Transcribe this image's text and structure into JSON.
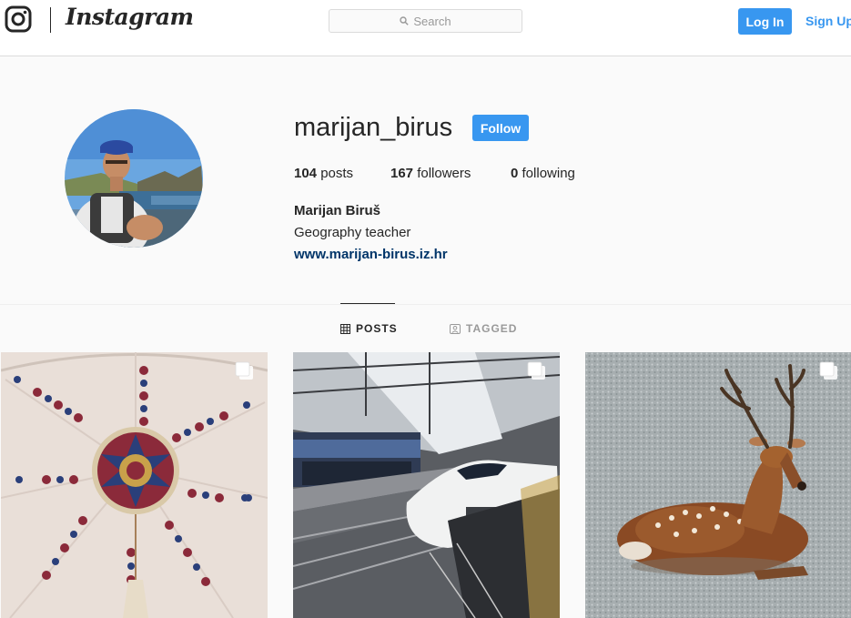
{
  "topbar": {
    "brand": "Instagram",
    "search_placeholder": "Search",
    "login_label": "Log In",
    "signup_label": "Sign Up"
  },
  "profile": {
    "username": "marijan_birus",
    "follow_label": "Follow",
    "posts_count": "104",
    "posts_label": "posts",
    "followers_count": "167",
    "followers_label": "followers",
    "following_count": "0",
    "following_label": "following",
    "full_name": "Marijan Biruš",
    "bio": "Geography teacher",
    "website": "www.marijan-birus.iz.hr"
  },
  "tabs": {
    "posts": "POSTS",
    "tagged": "TAGGED"
  },
  "colors": {
    "accent": "#3897f0",
    "link": "#003569",
    "text": "#262626",
    "muted": "#999999"
  },
  "posts": [
    {
      "icon": "multiple-photos-icon"
    },
    {
      "icon": "multiple-photos-icon"
    },
    {
      "icon": "multiple-photos-icon"
    }
  ]
}
